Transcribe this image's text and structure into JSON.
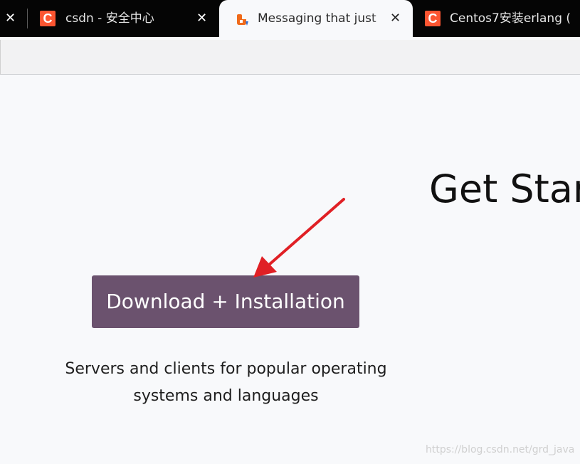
{
  "browser": {
    "tabs": [
      {
        "title": "csdn - 安全中心",
        "favicon": "csdn-c-icon"
      },
      {
        "title": "Messaging that just",
        "favicon": "rabbitmq-icon",
        "active": true
      },
      {
        "title": "Centos7安装erlang (",
        "favicon": "csdn-c-icon"
      }
    ],
    "close_glyph": "✕"
  },
  "page": {
    "heading": "Get Star",
    "download_button": "Download + Installation",
    "description": "Servers and clients for popular operating systems and languages",
    "watermark": "https://blog.csdn.net/grd_java"
  },
  "colors": {
    "tabbar": "#050505",
    "csdn_brand": "#fc5531",
    "button": "#6b526e",
    "arrow": "#e02025"
  }
}
